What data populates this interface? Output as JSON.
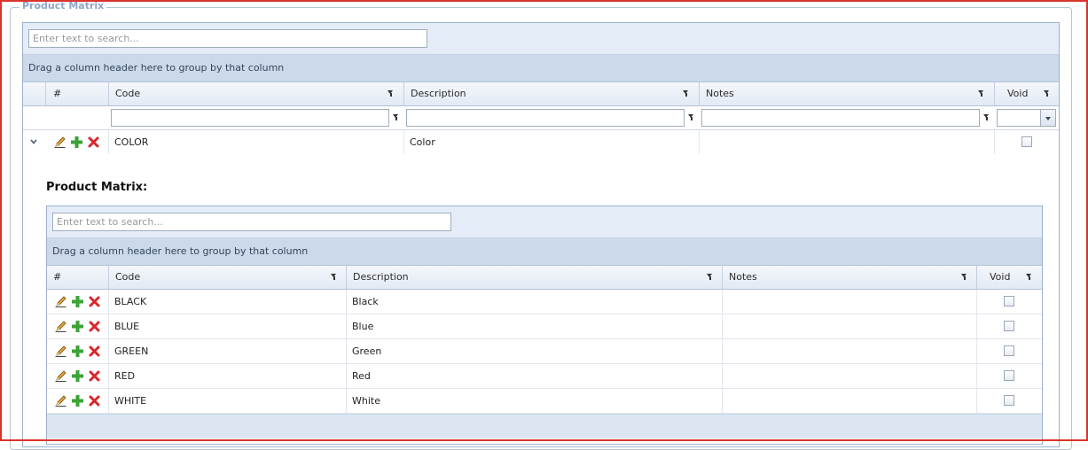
{
  "fieldset": {
    "legend": "Product Matrix"
  },
  "outer_grid": {
    "search_placeholder": "Enter text to search...",
    "group_panel_text": "Drag a column header here to group by that column",
    "columns": {
      "num": "#",
      "code": "Code",
      "description": "Description",
      "notes": "Notes",
      "void": "Void"
    },
    "rows": [
      {
        "code": "COLOR",
        "description": "Color",
        "notes": "",
        "void": false,
        "expanded": true
      }
    ]
  },
  "detail": {
    "title": "Product Matrix:",
    "search_placeholder": "Enter text to search...",
    "group_panel_text": "Drag a column header here to group by that column",
    "columns": {
      "num": "#",
      "code": "Code",
      "description": "Description",
      "notes": "Notes",
      "void": "Void"
    },
    "rows": [
      {
        "code": "BLACK",
        "description": "Black",
        "notes": "",
        "void": false
      },
      {
        "code": "BLUE",
        "description": "Blue",
        "notes": "",
        "void": false
      },
      {
        "code": "GREEN",
        "description": "Green",
        "notes": "",
        "void": false
      },
      {
        "code": "RED",
        "description": "Red",
        "notes": "",
        "void": false
      },
      {
        "code": "WHITE",
        "description": "White",
        "notes": "",
        "void": false
      }
    ]
  },
  "icons": {
    "edit": "pencil-icon",
    "add": "plus-icon",
    "delete": "delete-x-icon",
    "expand": "chevron-down-icon",
    "filter": "funnel-icon"
  },
  "colors": {
    "frame": "#d9342b",
    "header_bg": "#e4ecf7",
    "group_panel_bg": "#ccd9ea",
    "legend": "#8ea5c8",
    "add_green": "#3aa335",
    "delete_red": "#d9262b"
  }
}
